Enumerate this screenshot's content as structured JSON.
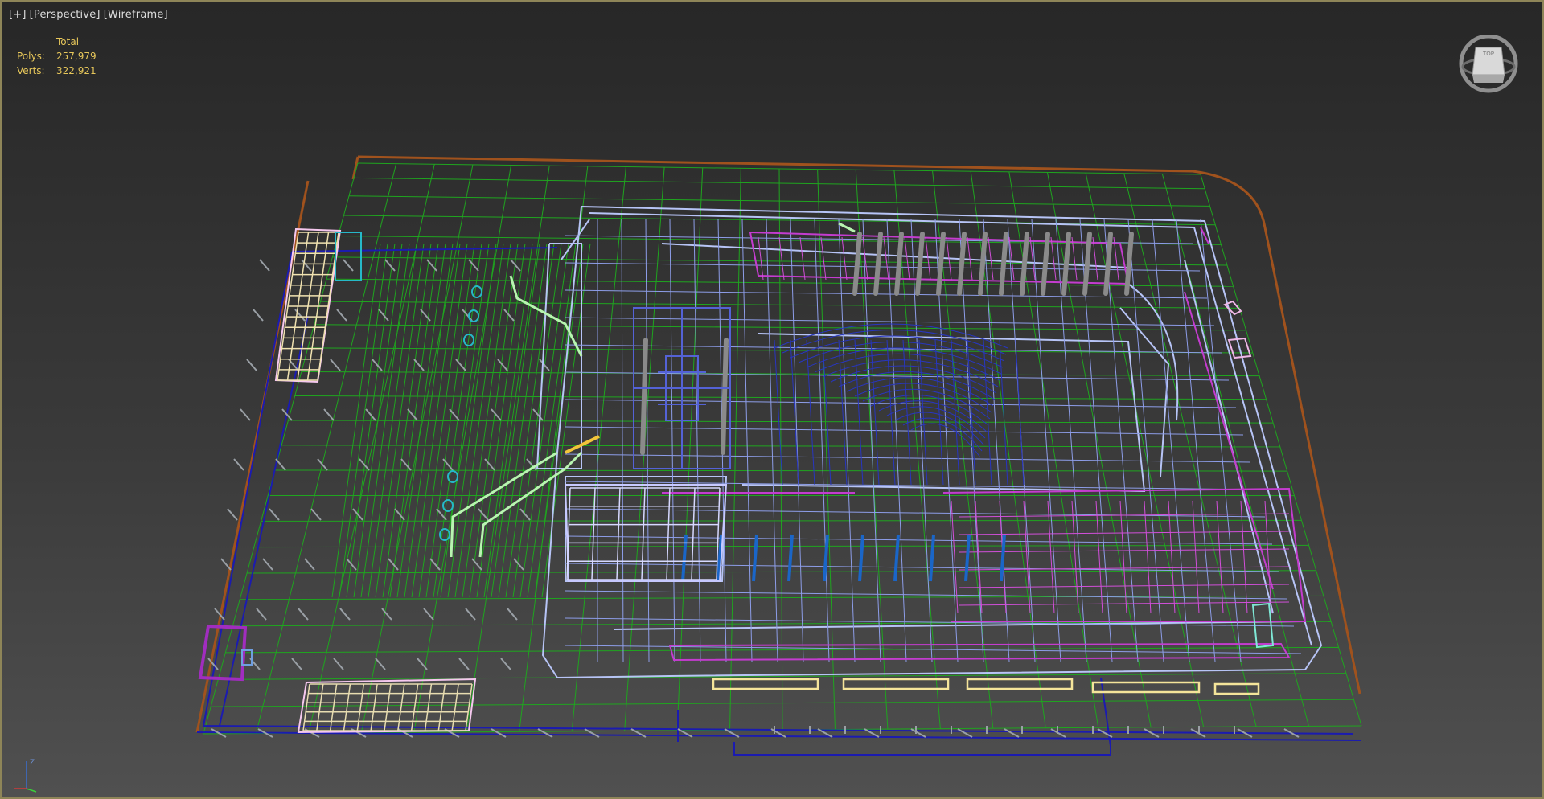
{
  "viewport": {
    "labels": [
      "[+]",
      "[Perspective]",
      "[Wireframe]"
    ],
    "stats": {
      "header": "Total",
      "rows": [
        {
          "label": "Polys:",
          "value": "257,979"
        },
        {
          "label": "Verts:",
          "value": "322,921"
        }
      ]
    },
    "viewcube": {
      "face_label": "TOP",
      "icon": "viewcube-icon"
    },
    "axis_tripod": {
      "icon": "axis-tripod-icon",
      "z_label": "Z"
    }
  },
  "colors": {
    "background": "#2e2e2e",
    "viewport_border": "#8e8558",
    "stats_text": "#e6c65a",
    "label_text": "#dddddd",
    "site_outline": "#a0521d",
    "site_grid": "#1fa51f",
    "base_lines": "#1b1bb0",
    "building_lines": "#b7c4f6",
    "magenta_lines": "#c43ccf",
    "pink_lines": "#f0b8e8",
    "cyan_lines": "#26b8c8",
    "light_green": "#b8f5b0",
    "yellow_lines": "#f4e49a",
    "grey_posts": "#8a8a8a",
    "dark_blue": "#1a3ccc"
  }
}
